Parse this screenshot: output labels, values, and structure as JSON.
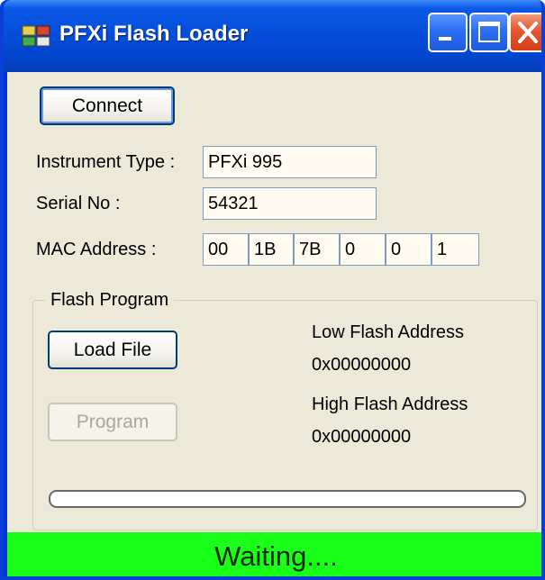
{
  "window": {
    "title": "PFXi Flash Loader"
  },
  "connect": {
    "label": "Connect"
  },
  "instrument": {
    "type_label": "Instrument Type :",
    "type_value": "PFXi 995",
    "serial_label": "Serial No :",
    "serial_value": "54321",
    "mac_label": "MAC Address :",
    "mac": [
      "00",
      "1B",
      "7B",
      "0",
      "0",
      "1"
    ]
  },
  "flash": {
    "group_title": "Flash Program",
    "load_label": "Load File",
    "program_label": "Program",
    "low_label": "Low Flash Address",
    "low_value": "0x00000000",
    "high_label": "High Flash Address",
    "high_value": "0x00000000",
    "progress_percent": 0
  },
  "status": {
    "text": "Waiting....",
    "color": "#1aff1a"
  },
  "colors": {
    "titlebar": "#0650dc",
    "client": "#ece9d8",
    "field_bg": "#fffbf0"
  }
}
